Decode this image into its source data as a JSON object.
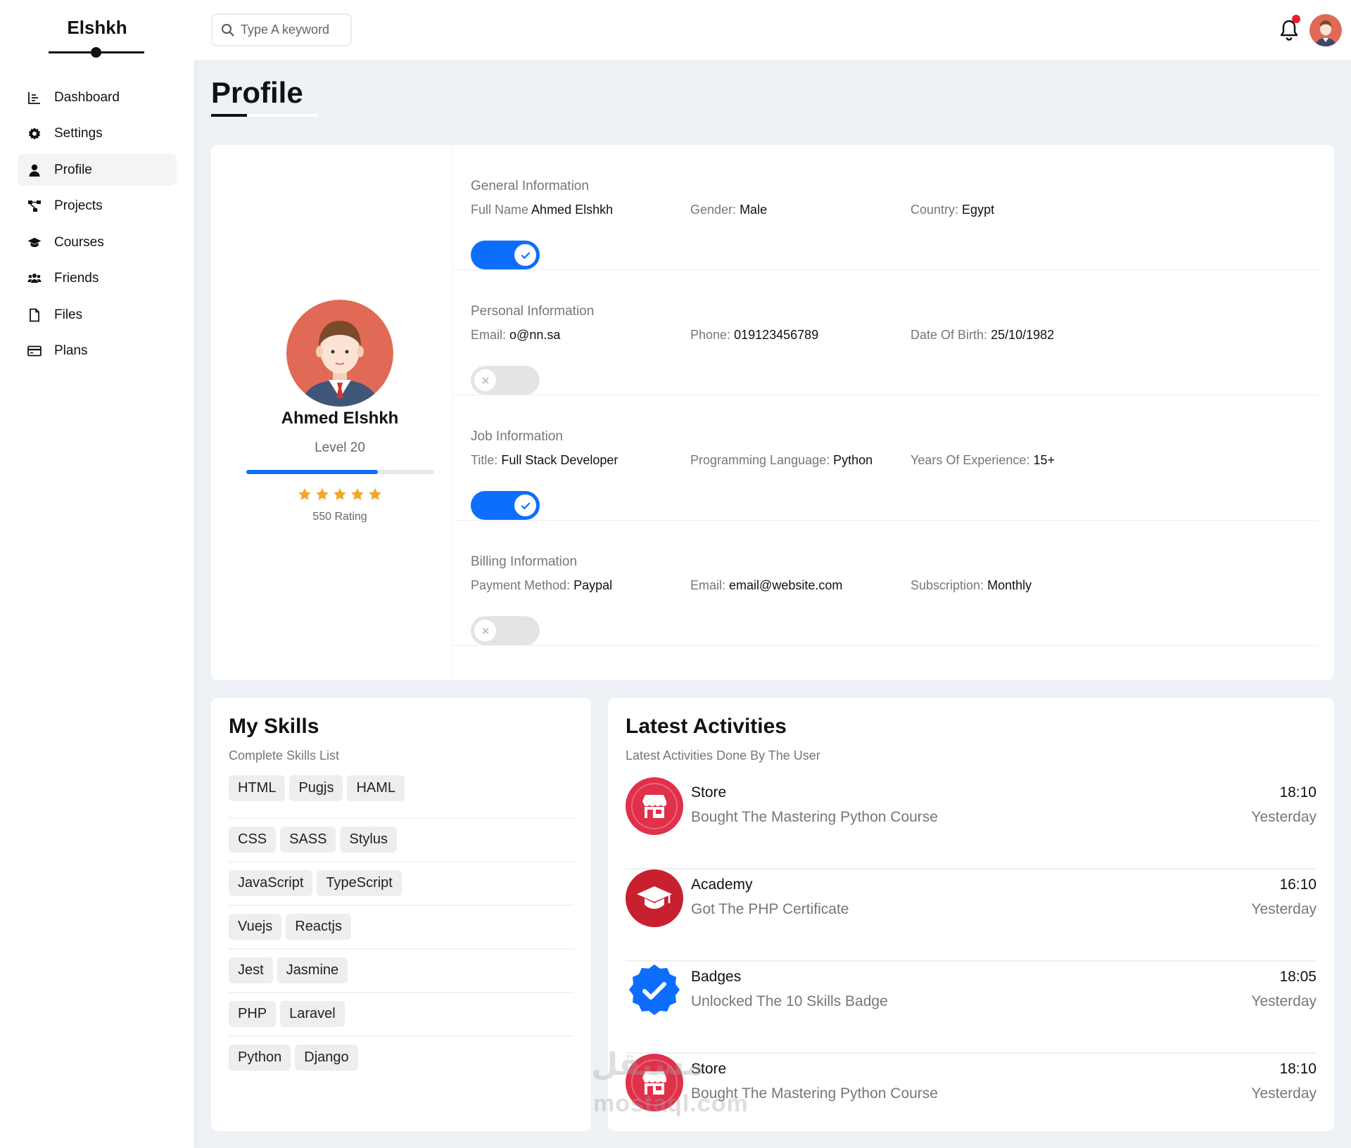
{
  "brand": "Elshkh",
  "nav": [
    {
      "label": "Dashboard",
      "icon": "chart-icon"
    },
    {
      "label": "Settings",
      "icon": "gear-icon"
    },
    {
      "label": "Profile",
      "icon": "user-icon",
      "active": true
    },
    {
      "label": "Projects",
      "icon": "diagram-icon"
    },
    {
      "label": "Courses",
      "icon": "graduation-cap-icon"
    },
    {
      "label": "Friends",
      "icon": "users-icon"
    },
    {
      "label": "Files",
      "icon": "file-icon"
    },
    {
      "label": "Plans",
      "icon": "credit-card-icon"
    }
  ],
  "search": {
    "placeholder": "Type A keyword"
  },
  "page": {
    "title": "Profile"
  },
  "profile": {
    "name": "Ahmed Elshkh",
    "level": "Level 20",
    "level_progress": 0.7,
    "stars": 5,
    "rating": "550 Rating"
  },
  "sections": [
    {
      "title": "General Information",
      "fields": [
        {
          "label": "Full Name",
          "value": "Ahmed Elshkh"
        },
        {
          "label": "Gender:",
          "value": "Male"
        },
        {
          "label": "Country:",
          "value": "Egypt"
        }
      ],
      "enabled": true
    },
    {
      "title": "Personal Information",
      "fields": [
        {
          "label": "Email:",
          "value": "o@nn.sa"
        },
        {
          "label": "Phone:",
          "value": "019123456789"
        },
        {
          "label": "Date Of Birth:",
          "value": "25/10/1982"
        }
      ],
      "enabled": false
    },
    {
      "title": "Job Information",
      "fields": [
        {
          "label": "Title:",
          "value": "Full Stack Developer"
        },
        {
          "label": "Programming Language:",
          "value": "Python"
        },
        {
          "label": "Years Of Experience:",
          "value": "15+"
        }
      ],
      "enabled": true
    },
    {
      "title": "Billing Information",
      "fields": [
        {
          "label": "Payment Method:",
          "value": "Paypal"
        },
        {
          "label": "Email:",
          "value": "email@website.com"
        },
        {
          "label": "Subscription:",
          "value": "Monthly"
        }
      ],
      "enabled": false
    }
  ],
  "skills": {
    "title": "My Skills",
    "subtitle": "Complete Skills List",
    "rows": [
      [
        "HTML",
        "Pugjs",
        "HAML"
      ],
      [
        "CSS",
        "SASS",
        "Stylus"
      ],
      [
        "JavaScript",
        "TypeScript"
      ],
      [
        "Vuejs",
        "Reactjs"
      ],
      [
        "Jest",
        "Jasmine"
      ],
      [
        "PHP",
        "Laravel"
      ],
      [
        "Python",
        "Django"
      ]
    ]
  },
  "activities": {
    "title": "Latest Activities",
    "subtitle": "Latest Activities Done By The User",
    "items": [
      {
        "icon": "store-icon",
        "title": "Store",
        "desc": "Bought The Mastering Python Course",
        "time": "18:10",
        "day": "Yesterday"
      },
      {
        "icon": "graduation-cap-icon",
        "title": "Academy",
        "desc": "Got The PHP Certificate",
        "time": "16:10",
        "day": "Yesterday"
      },
      {
        "icon": "verified-badge-icon",
        "title": "Badges",
        "desc": "Unlocked The 10 Skills Badge",
        "time": "18:05",
        "day": "Yesterday"
      },
      {
        "icon": "store-icon",
        "title": "Store",
        "desc": "Bought The Mastering Python Course",
        "time": "18:10",
        "day": "Yesterday"
      }
    ]
  },
  "watermark": {
    "arabic": "مستقل",
    "latin": "mostaql.com"
  },
  "colors": {
    "accent": "#0d6efd",
    "star": "#f5a623",
    "notification": "#e5202f",
    "store": "#e0304a",
    "academy": "#c8202f"
  }
}
